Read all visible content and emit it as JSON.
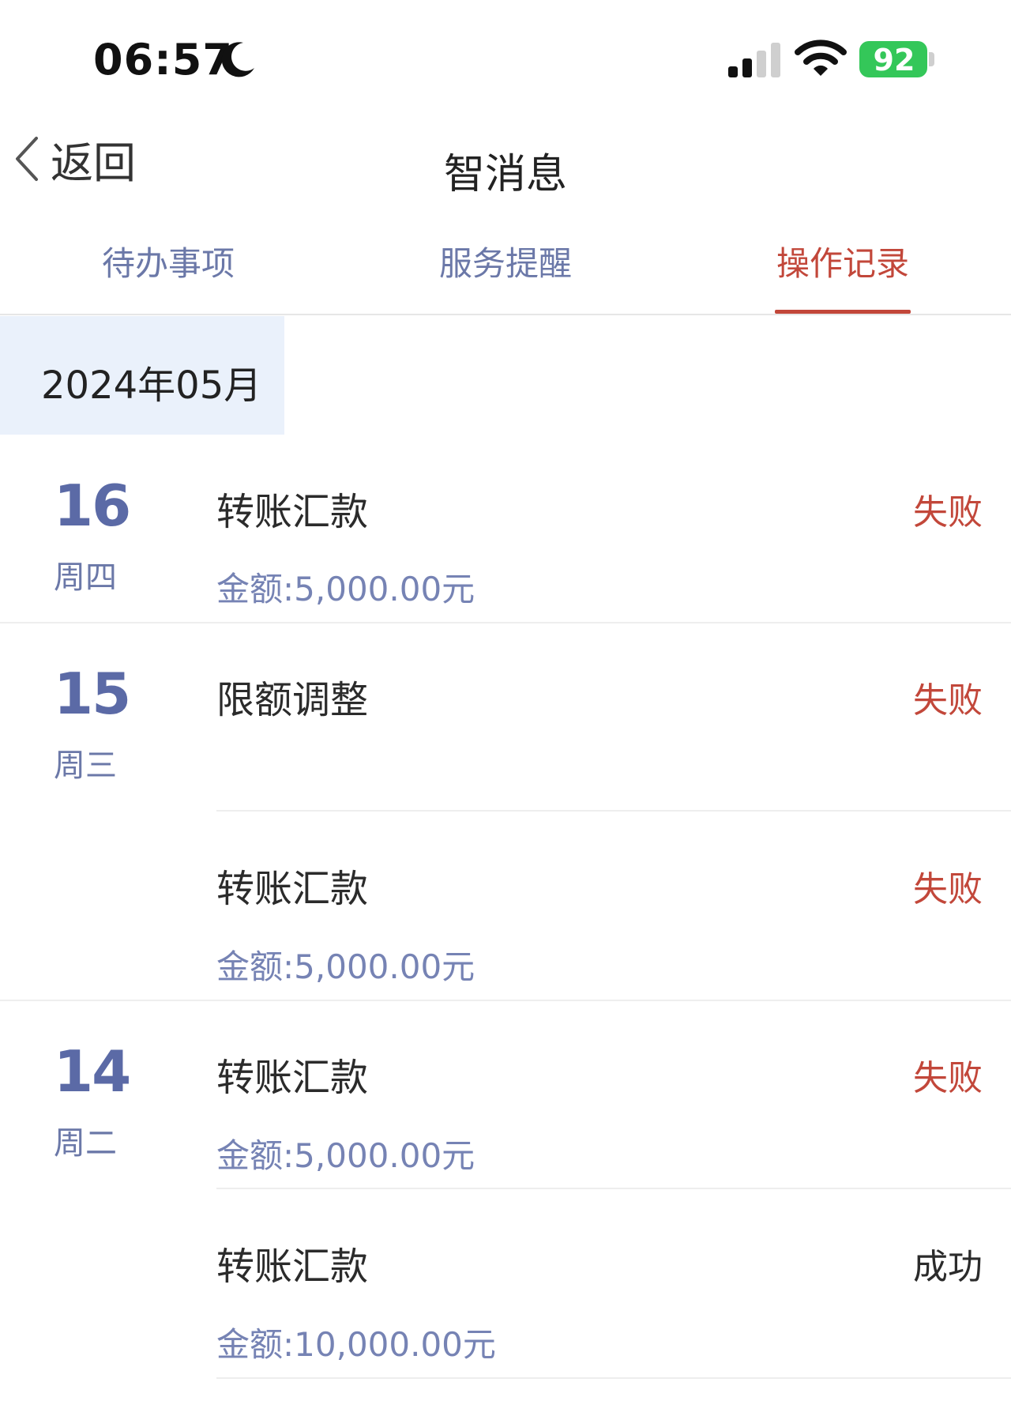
{
  "status_bar": {
    "time": "06:57",
    "battery": "92",
    "icons": [
      "moon-icon",
      "cellular-signal-icon",
      "wifi-icon",
      "battery-charging-icon"
    ]
  },
  "nav": {
    "back_label": "返回",
    "title": "智消息"
  },
  "tabs": [
    {
      "label": "待办事项",
      "active": false
    },
    {
      "label": "服务提醒",
      "active": false
    },
    {
      "label": "操作记录",
      "active": true
    }
  ],
  "month": "2024年05月",
  "days": [
    {
      "day": "16",
      "weekday": "周四",
      "records": [
        {
          "title": "转账汇款",
          "amount": "金额:5,000.00元",
          "status": "失败"
        }
      ]
    },
    {
      "day": "15",
      "weekday": "周三",
      "records": [
        {
          "title": "限额调整",
          "amount": "",
          "status": "失败"
        },
        {
          "title": "转账汇款",
          "amount": "金额:5,000.00元",
          "status": "失败"
        }
      ]
    },
    {
      "day": "14",
      "weekday": "周二",
      "records": [
        {
          "title": "转账汇款",
          "amount": "金额:5,000.00元",
          "status": "失败"
        },
        {
          "title": "转账汇款",
          "amount": "金额:10,000.00元",
          "status": "成功"
        }
      ]
    }
  ],
  "colors": {
    "accent": "#c2473a",
    "tab_inactive": "#6b78a8",
    "day_number": "#5b6aa6",
    "amount": "#7683b4",
    "battery": "#34c759",
    "month_bg": "#eaf1fb"
  }
}
